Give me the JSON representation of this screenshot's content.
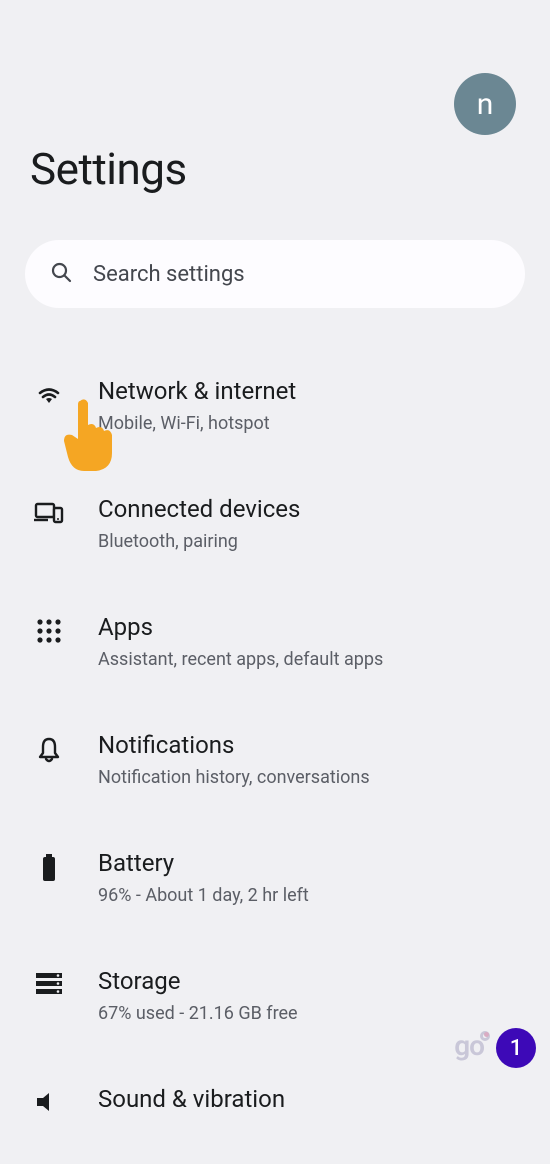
{
  "header": {
    "avatar_initial": "n",
    "title": "Settings"
  },
  "search": {
    "placeholder": "Search settings"
  },
  "items": [
    {
      "id": "network",
      "icon": "wifi",
      "title": "Network & internet",
      "sub": "Mobile, Wi-Fi, hotspot"
    },
    {
      "id": "connected",
      "icon": "devices",
      "title": "Connected devices",
      "sub": "Bluetooth, pairing"
    },
    {
      "id": "apps",
      "icon": "apps",
      "title": "Apps",
      "sub": "Assistant, recent apps, default apps"
    },
    {
      "id": "notifications",
      "icon": "bell",
      "title": "Notifications",
      "sub": "Notification history, conversations"
    },
    {
      "id": "battery",
      "icon": "battery",
      "title": "Battery",
      "sub": "96% - About 1 day, 2 hr left"
    },
    {
      "id": "storage",
      "icon": "storage",
      "title": "Storage",
      "sub": "67% used - 21.16 GB free"
    },
    {
      "id": "sound",
      "icon": "volume",
      "title": "Sound & vibration",
      "sub": ""
    }
  ],
  "overlay": {
    "badge_count": "1",
    "logo_text": "go"
  }
}
